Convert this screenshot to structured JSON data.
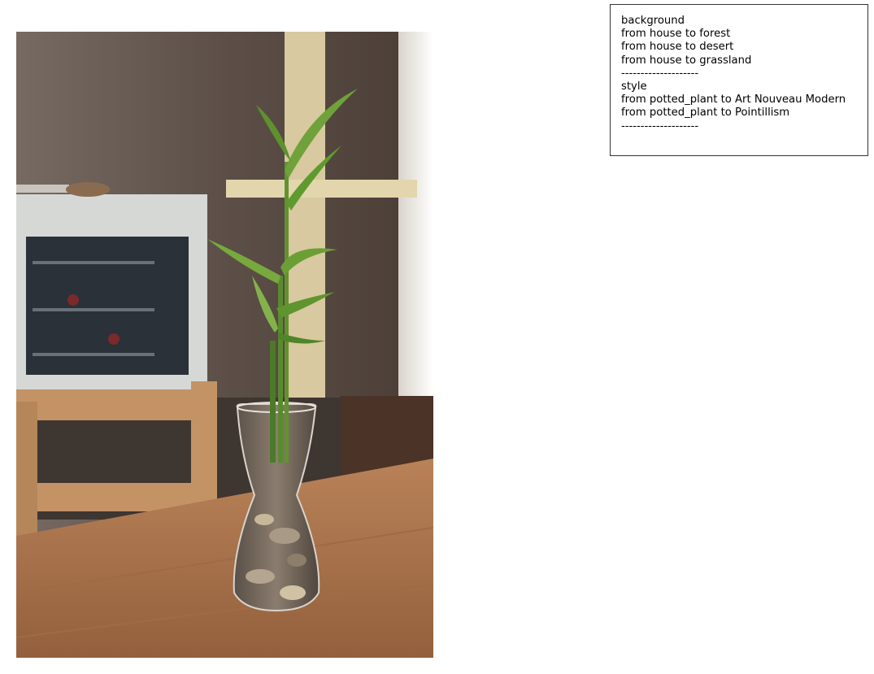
{
  "legend": {
    "lines": [
      "background",
      "from house to forest",
      "from house to desert",
      "from house to grassland",
      "--------------------",
      "style",
      "from potted_plant to Art Nouveau Modern",
      "from potted_plant to Pointillism",
      "--------------------"
    ]
  },
  "photo": {
    "subject": "bamboo-plant-in-glass-vase"
  }
}
